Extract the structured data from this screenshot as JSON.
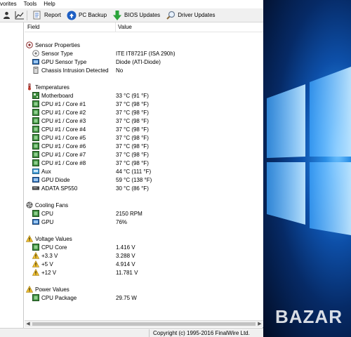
{
  "menu": [
    "vorites",
    "Tools",
    "Help"
  ],
  "toolbar": {
    "report": "Report",
    "pc_backup": "PC Backup",
    "bios_updates": "BIOS Updates",
    "driver_updates": "Driver Updates"
  },
  "columns": {
    "field": "Field",
    "value": "Value"
  },
  "sensor_properties": {
    "title": "Sensor Properties",
    "items": [
      {
        "label": "Sensor Type",
        "value": "ITE IT8721F  (ISA 290h)",
        "icon": "sensor-chip-icon"
      },
      {
        "label": "GPU Sensor Type",
        "value": "Diode  (ATI-Diode)",
        "icon": "gpu-icon"
      },
      {
        "label": "Chassis Intrusion Detected",
        "value": "No",
        "icon": "chassis-icon"
      }
    ]
  },
  "temperatures": {
    "title": "Temperatures",
    "items": [
      {
        "label": "Motherboard",
        "value": "33 °C  (91 °F)",
        "icon": "motherboard-icon"
      },
      {
        "label": "CPU #1 / Core #1",
        "value": "37 °C  (98 °F)",
        "icon": "cpu-icon"
      },
      {
        "label": "CPU #1 / Core #2",
        "value": "37 °C  (98 °F)",
        "icon": "cpu-icon"
      },
      {
        "label": "CPU #1 / Core #3",
        "value": "37 °C  (98 °F)",
        "icon": "cpu-icon"
      },
      {
        "label": "CPU #1 / Core #4",
        "value": "37 °C  (98 °F)",
        "icon": "cpu-icon"
      },
      {
        "label": "CPU #1 / Core #5",
        "value": "37 °C  (98 °F)",
        "icon": "cpu-icon"
      },
      {
        "label": "CPU #1 / Core #6",
        "value": "37 °C  (98 °F)",
        "icon": "cpu-icon"
      },
      {
        "label": "CPU #1 / Core #7",
        "value": "37 °C  (98 °F)",
        "icon": "cpu-icon"
      },
      {
        "label": "CPU #1 / Core #8",
        "value": "37 °C  (98 °F)",
        "icon": "cpu-icon"
      },
      {
        "label": "Aux",
        "value": "44 °C  (111 °F)",
        "icon": "aux-icon"
      },
      {
        "label": "GPU Diode",
        "value": "59 °C  (138 °F)",
        "icon": "gpu-icon"
      },
      {
        "label": "ADATA SP550",
        "value": "30 °C  (86 °F)",
        "icon": "drive-icon"
      }
    ]
  },
  "cooling_fans": {
    "title": "Cooling Fans",
    "items": [
      {
        "label": "CPU",
        "value": "2150 RPM",
        "icon": "cpu-icon"
      },
      {
        "label": "GPU",
        "value": "76%",
        "icon": "gpu-icon"
      }
    ]
  },
  "voltage_values": {
    "title": "Voltage Values",
    "items": [
      {
        "label": "CPU Core",
        "value": "1.416 V",
        "icon": "cpu-icon"
      },
      {
        "label": "+3.3 V",
        "value": "3.288 V",
        "icon": "warning-icon"
      },
      {
        "label": "+5 V",
        "value": "4.914 V",
        "icon": "warning-icon"
      },
      {
        "label": "+12 V",
        "value": "11.781 V",
        "icon": "warning-icon"
      }
    ]
  },
  "power_values": {
    "title": "Power Values",
    "items": [
      {
        "label": "CPU Package",
        "value": "29.75 W",
        "icon": "cpu-icon"
      }
    ]
  },
  "status": {
    "copyright": "Copyright (c) 1995-2016 FinalWire Ltd."
  },
  "watermark": "BAZAR",
  "colors": {
    "desktop_blue": "#0d4fa8",
    "cpu_green": "#3a8a3a",
    "warning_yellow": "#f2c230"
  }
}
